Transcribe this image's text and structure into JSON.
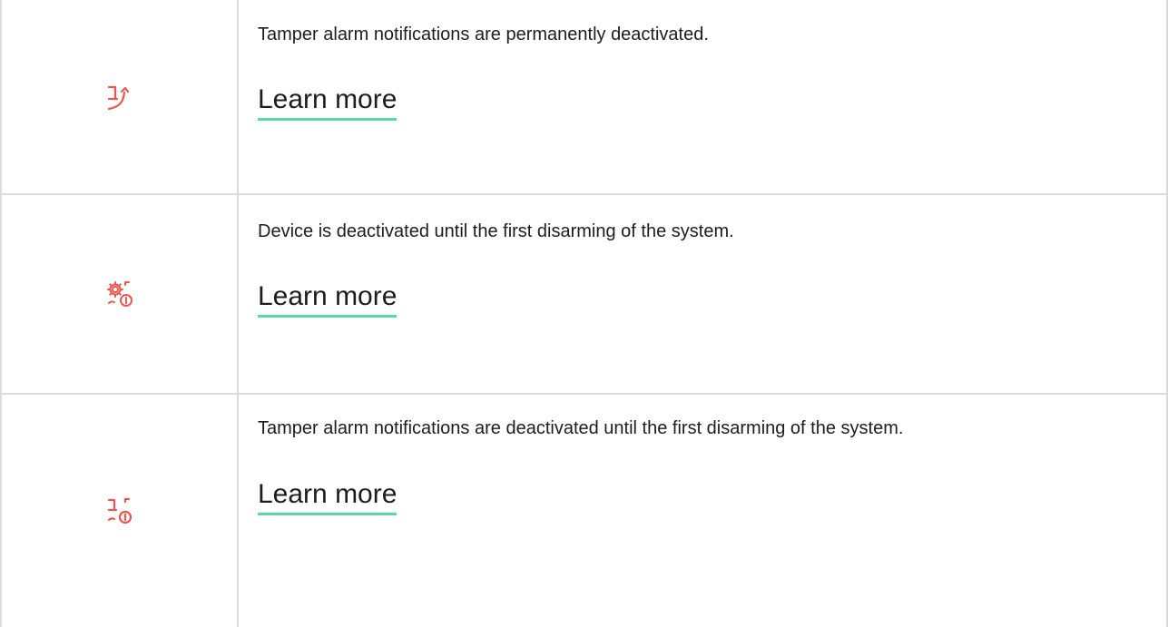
{
  "colors": {
    "icon": "#e8574e",
    "link_underline": "#5cd9a0",
    "border": "#dcdcdc",
    "text": "#1d1d1d"
  },
  "rows": [
    {
      "icon": "tamper-permanently-deactivated-icon",
      "description": "Tamper alarm notifications are permanently deactivated.",
      "link": "Learn more"
    },
    {
      "icon": "device-deactivated-until-disarm-icon",
      "description": "Device is deactivated until the first disarming of the system.",
      "link": "Learn more"
    },
    {
      "icon": "tamper-deactivated-until-disarm-icon",
      "description": "Tamper alarm notifications are deactivated until the first disarming of the system.",
      "link": "Learn more"
    }
  ]
}
